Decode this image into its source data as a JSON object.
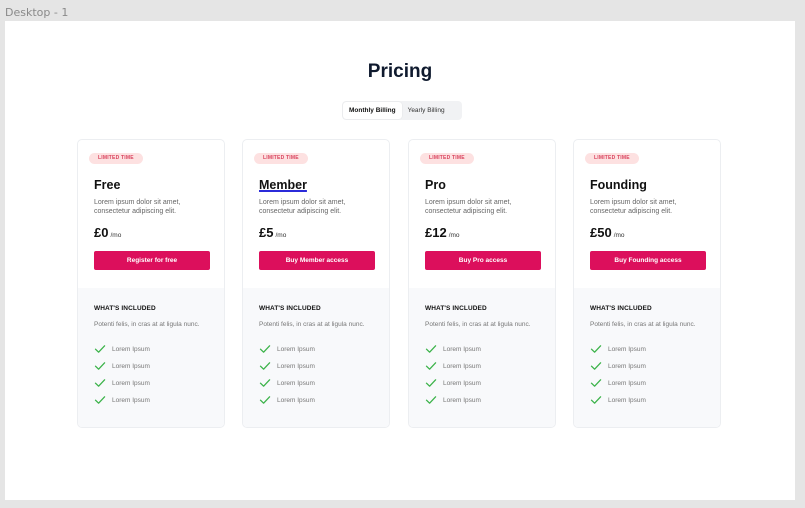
{
  "canvas": {
    "frame_label": "Desktop - 1"
  },
  "header": {
    "title": "Pricing"
  },
  "billing_toggle": {
    "options": [
      {
        "label": "Monthly Billing",
        "active": true
      },
      {
        "label": "Yearly Billing",
        "active": false
      }
    ]
  },
  "colors": {
    "accent": "#dc0f5c",
    "badge_bg": "#fde1e1",
    "badge_text": "#d9435e",
    "check": "#3cb34a"
  },
  "plans": [
    {
      "badge": "LIMITED TIME",
      "name": "Free",
      "description": "Lorem ipsum dolor sit amet, consectetur adipiscing elit.",
      "price": "£0",
      "period": "/mo",
      "cta": "Register for free",
      "included_title": "WHAT'S INCLUDED",
      "included_desc": "Potenti felis, in cras at at ligula nunc.",
      "features": [
        "Lorem Ipsum",
        "Lorem Ipsum",
        "Lorem Ipsum",
        "Lorem Ipsum"
      ]
    },
    {
      "badge": "LIMITED TIME",
      "name": "Member",
      "description": "Lorem ipsum dolor sit amet, consectetur adipiscing elit.",
      "price": "£5",
      "period": "/mo",
      "cta": "Buy Member access",
      "included_title": "WHAT'S INCLUDED",
      "included_desc": "Potenti felis, in cras at at ligula nunc.",
      "features": [
        "Lorem Ipsum",
        "Lorem Ipsum",
        "Lorem Ipsum",
        "Lorem Ipsum"
      ]
    },
    {
      "badge": "LIMITED TIME",
      "name": "Pro",
      "description": "Lorem ipsum dolor sit amet, consectetur adipiscing elit.",
      "price": "£12",
      "period": "/mo",
      "cta": "Buy Pro access",
      "included_title": "WHAT'S INCLUDED",
      "included_desc": "Potenti felis, in cras at at ligula nunc.",
      "features": [
        "Lorem Ipsum",
        "Lorem Ipsum",
        "Lorem Ipsum",
        "Lorem Ipsum"
      ]
    },
    {
      "badge": "LIMITED TIME",
      "name": "Founding",
      "description": "Lorem ipsum dolor sit amet, consectetur adipiscing elit.",
      "price": "£50",
      "period": "/mo",
      "cta": "Buy Founding access",
      "included_title": "WHAT'S INCLUDED",
      "included_desc": "Potenti felis, in cras at at ligula nunc.",
      "features": [
        "Lorem Ipsum",
        "Lorem Ipsum",
        "Lorem Ipsum",
        "Lorem Ipsum"
      ]
    }
  ]
}
